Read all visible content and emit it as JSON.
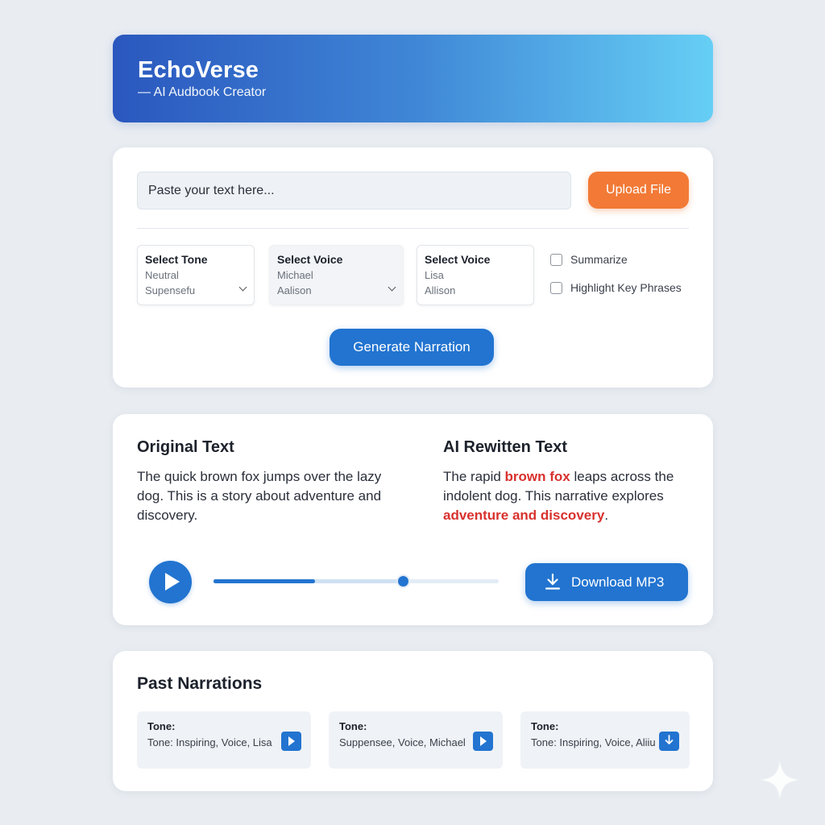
{
  "header": {
    "title": "EchoVerse",
    "subtitle": "— AI Audbook Creator"
  },
  "input": {
    "text_placeholder": "Paste your text here...",
    "upload_label": "Upload File",
    "selects": [
      {
        "label": "Select Tone",
        "options": [
          "Neutral",
          "Supensefu"
        ]
      },
      {
        "label": "Select Voice",
        "options": [
          "Michael",
          "Aalison"
        ]
      },
      {
        "label": "Select Voice",
        "options": [
          "Lisa",
          "Allison"
        ]
      }
    ],
    "checkboxes": [
      {
        "label": "Summarize",
        "checked": false
      },
      {
        "label": "Highlight Key Phrases",
        "checked": false
      }
    ],
    "generate_label": "Generate Narration"
  },
  "compare": {
    "original_title": "Original Text",
    "original_text": "The quick brown fox jumps over the lazy dog. This is a story about adventure and discovery.",
    "rewritten_title": "AI Rewitten Text",
    "rewritten_parts": {
      "p1": "The rapid ",
      "h1": "brown fox",
      "p2": " leaps across the indolent dog. This narrative explores ",
      "h2": "adventure and discovery",
      "p3": "."
    },
    "highlight_color": "#d8312e"
  },
  "player": {
    "played_fraction": 0.355,
    "buffered_fraction": 0.665,
    "download_label": "Download MP3",
    "play_icon": "play-icon",
    "download_icon": "download-icon"
  },
  "past": {
    "title": "Past Narrations",
    "items": [
      {
        "tone_label": "Tone:",
        "description": "Tone: Inspiring, Voice, Lisa",
        "action_icon": "play-icon"
      },
      {
        "tone_label": "Tone:",
        "description": "Suppensee, Voice, Michael",
        "action_icon": "play-icon"
      },
      {
        "tone_label": "Tone:",
        "description": "Tone: Inspiring, Voice, Aliiu",
        "action_icon": "download-icon"
      }
    ]
  },
  "colors": {
    "accent": "#2274d0",
    "upload": "#f27a36",
    "header_gradient_start": "#2a57be",
    "header_gradient_end": "#66cff5"
  }
}
